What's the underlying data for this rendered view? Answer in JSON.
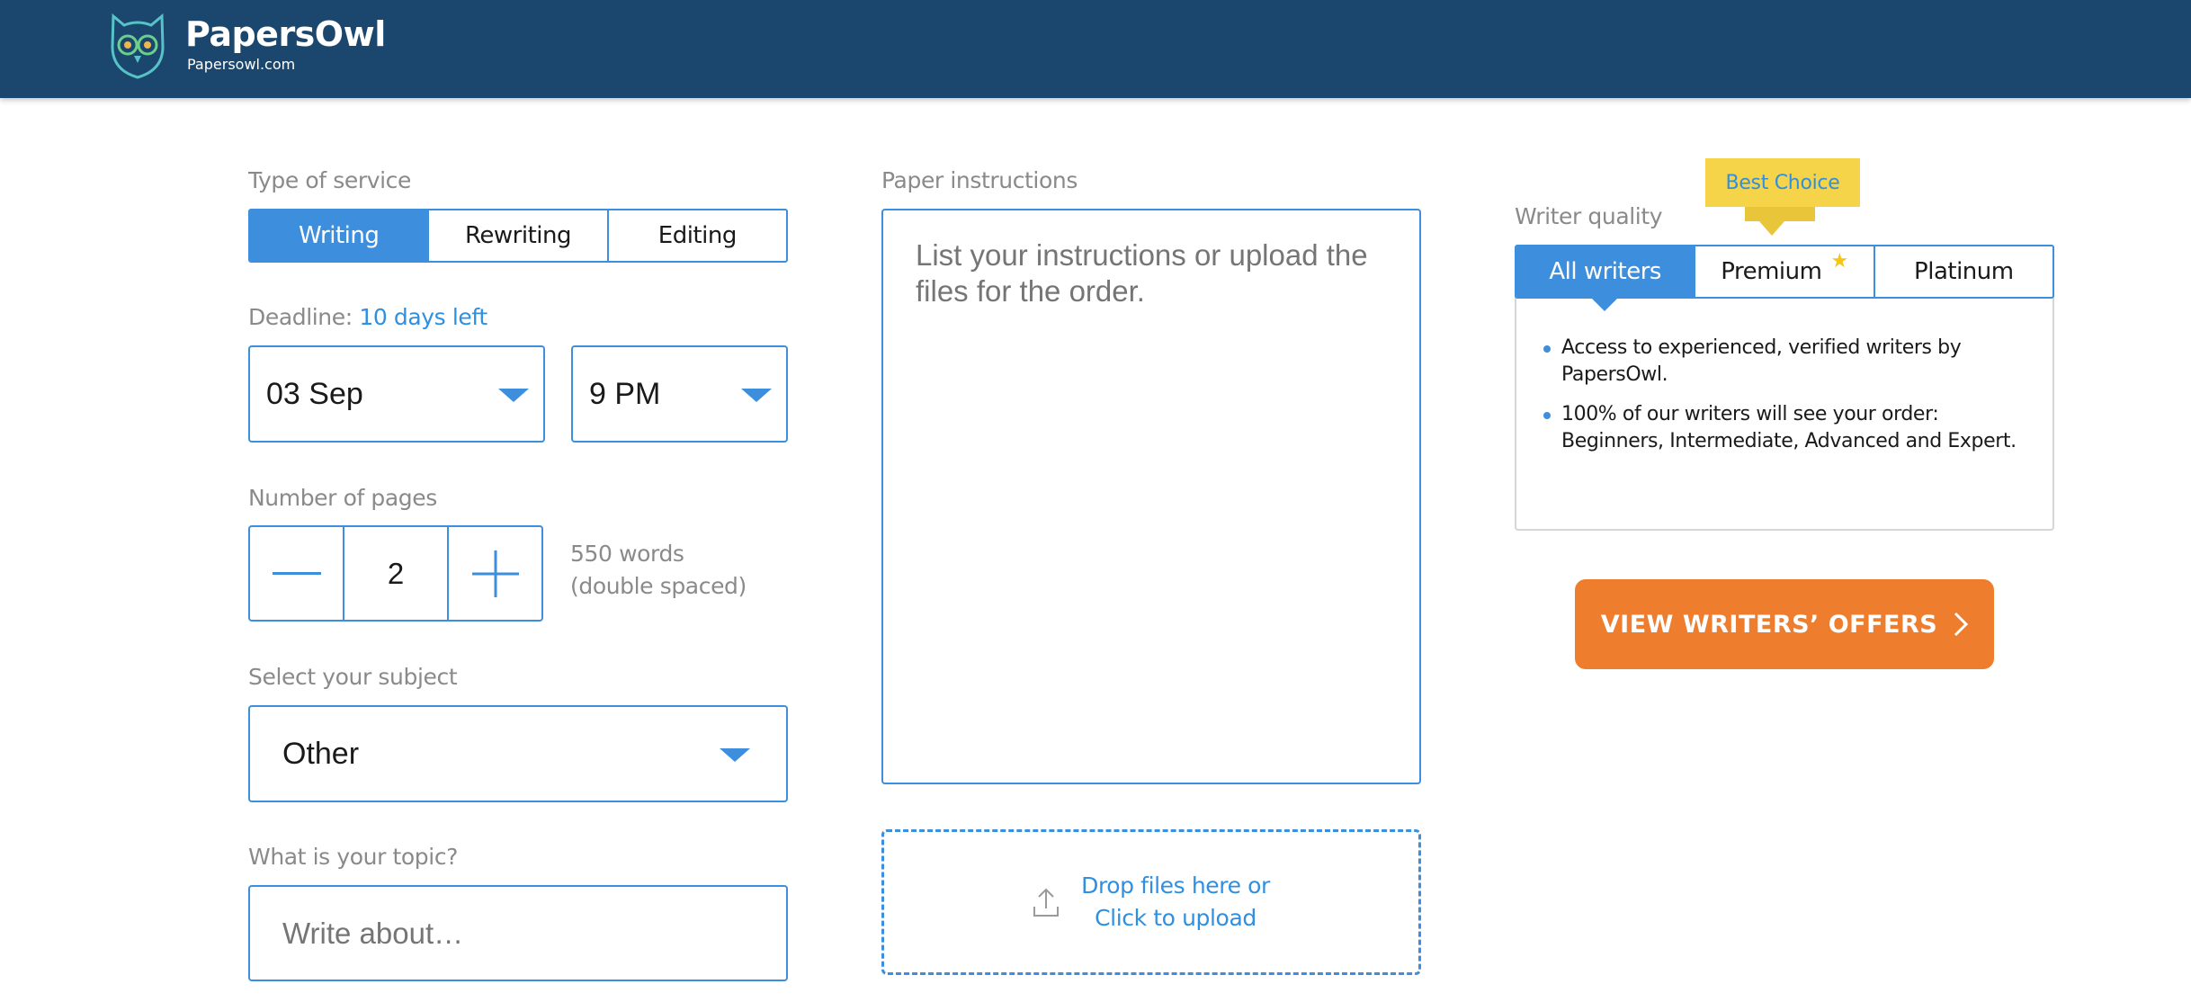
{
  "header": {
    "brand_name": "PapersOwl",
    "brand_domain": "Papersowl.com"
  },
  "service": {
    "label": "Type of service",
    "options": [
      "Writing",
      "Rewriting",
      "Editing"
    ],
    "selected": "Writing"
  },
  "deadline": {
    "label": "Deadline:",
    "remaining": "10 days left",
    "date": "03 Sep",
    "time": "9 PM"
  },
  "pages": {
    "label": "Number of pages",
    "count": "2",
    "words_line1": "550 words",
    "words_line2": "(double spaced)"
  },
  "subject": {
    "label": "Select your subject",
    "value": "Other"
  },
  "topic": {
    "label": "What is your topic?",
    "placeholder": "Write about…"
  },
  "instructions": {
    "label": "Paper instructions",
    "placeholder": "List your instructions or upload the files for the order."
  },
  "upload": {
    "line1": "Drop files here or",
    "line2": "Click to upload"
  },
  "writer_quality": {
    "label": "Writer quality",
    "badge": "Best Choice",
    "tabs": [
      "All writers",
      "Premium",
      "Platinum"
    ],
    "selected": "All writers",
    "features": [
      "Access to experienced, verified writers by PapersOwl.",
      "100% of our writers will see your order: Beginners, Intermediate, Advanced and Expert."
    ]
  },
  "cta": {
    "label": "VIEW WRITERS’ OFFERS"
  },
  "colors": {
    "header_bg": "#1b476e",
    "accent_blue": "#3d8fdd",
    "cta_orange": "#ee7d2d",
    "badge_yellow": "#f6d44a"
  }
}
